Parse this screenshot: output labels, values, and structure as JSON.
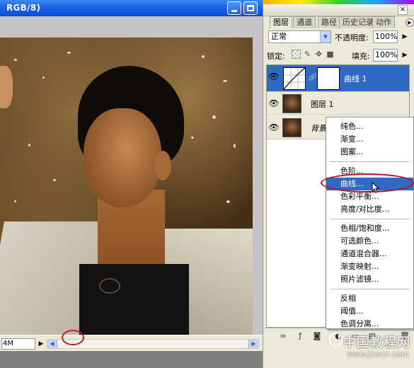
{
  "document": {
    "title": "RGB/8)",
    "status_value": "4M",
    "status_arrow": "▶"
  },
  "layers_panel": {
    "tabs": [
      {
        "label": "图层",
        "active": true
      },
      {
        "label": "通道"
      },
      {
        "label": "路径"
      },
      {
        "label": "历史记录"
      },
      {
        "label": "动作"
      }
    ],
    "close_label": "×",
    "tabs_menu_label": "▶",
    "blend_mode": "正常",
    "opacity_label": "不透明度:",
    "opacity_value": "100%",
    "lock_label": "锁定:",
    "fill_label": "填充:",
    "fill_value": "100%",
    "layers": [
      {
        "name": "曲线 1",
        "visible": true,
        "selected": true
      },
      {
        "name": "图层 1",
        "visible": true
      },
      {
        "name": "背景",
        "visible": true
      }
    ],
    "footer_icons": [
      "link-icon",
      "layer-style-icon",
      "add-mask-icon",
      "adjustment-layer-icon",
      "group-icon",
      "new-layer-icon",
      "trash-icon"
    ]
  },
  "context_menu": {
    "groups": [
      [
        "纯色...",
        "渐变...",
        "图案..."
      ],
      [
        "色阶...",
        "曲线...",
        "色彩平衡...",
        "亮度/对比度..."
      ],
      [
        "色相/饱和度...",
        "可选颜色...",
        "通道混合器...",
        "渐变映射...",
        "照片滤镜..."
      ],
      [
        "反相",
        "阈值...",
        "色调分离..."
      ]
    ],
    "highlighted": "曲线..."
  },
  "watermark": {
    "text": "中国教程网",
    "url": "www.jcwcn.com"
  },
  "colors": {
    "titlebar": "#1a62e6",
    "selection": "#316ac5",
    "annotation_red": "#c01c28",
    "panel_bg": "#ece9d8"
  }
}
